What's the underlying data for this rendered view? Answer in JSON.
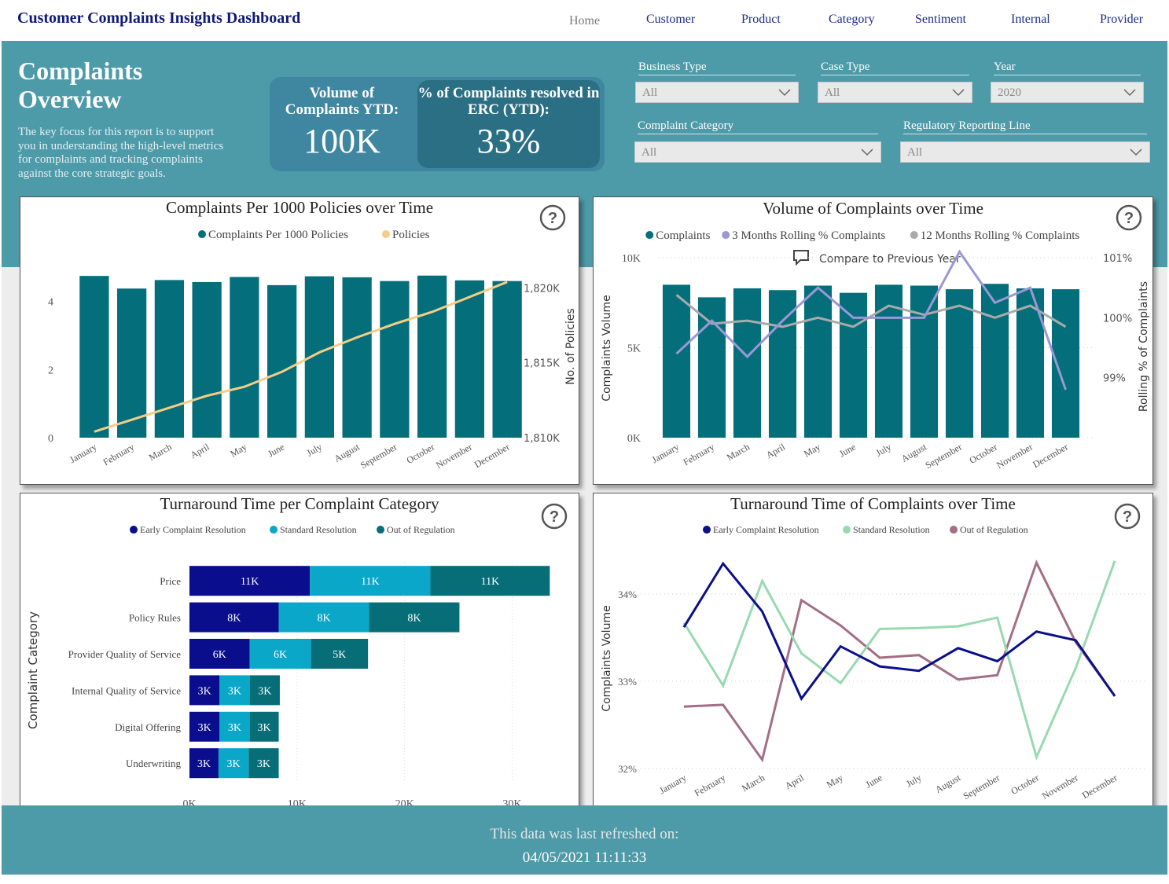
{
  "app": {
    "title": "Customer Complaints Insights Dashboard"
  },
  "nav": [
    "Home",
    "Customer",
    "Product",
    "Category",
    "Sentiment",
    "Internal",
    "Provider"
  ],
  "overview": {
    "title": "Complaints Overview",
    "description": "The key focus for this report is to support you in understanding the high-level metrics for complaints and tracking complaints against the core strategic goals."
  },
  "kpis": {
    "volume_label": "Volume of Complaints YTD:",
    "volume_value": "100K",
    "erc_label": "% of Complaints resolved in ERC (YTD):",
    "erc_value": "33%"
  },
  "filters": {
    "business_type": {
      "label": "Business Type",
      "value": "All"
    },
    "case_type": {
      "label": "Case Type",
      "value": "All"
    },
    "year": {
      "label": "Year",
      "value": "2020"
    },
    "complaint_category": {
      "label": "Complaint Category",
      "value": "All"
    },
    "regulatory_line": {
      "label": "Regulatory Reporting Line",
      "value": "All"
    }
  },
  "footer": {
    "refresh_label": "This data was last refreshed on:",
    "refresh_time": "04/05/2021 11:11:33"
  },
  "icons": {
    "help": "help-circle-icon",
    "compare": "comment-icon",
    "dropdown": "chevron-down-icon"
  },
  "colors": {
    "teal": "#046f7a",
    "policies": "#f6cd86",
    "rolling3": "#9a97d6",
    "rolling12": "#aaaaaa",
    "ecr": "#0a0e8c",
    "standard": "#0aa7c9",
    "oor": "#076e78",
    "ecr_line": "#0b0f8a",
    "standard_line": "#98d9b0",
    "oor_line": "#a26f85",
    "band": "#4d9aa8"
  },
  "chart_data": [
    {
      "type": "bar",
      "title": "Complaints Per 1000 Policies over Time",
      "legend": [
        "Complaints Per 1000 Policies",
        "Policies"
      ],
      "categories": [
        "January",
        "February",
        "March",
        "April",
        "May",
        "June",
        "July",
        "August",
        "September",
        "October",
        "November",
        "December"
      ],
      "series": [
        {
          "name": "Complaints Per 1000 Policies",
          "type": "bar",
          "axis": "left",
          "values": [
            4.75,
            4.38,
            4.63,
            4.57,
            4.72,
            4.48,
            4.74,
            4.71,
            4.6,
            4.76,
            4.62,
            4.6
          ]
        },
        {
          "name": "Policies",
          "type": "line",
          "axis": "right",
          "values": [
            1810.4,
            1811.2,
            1812.0,
            1812.8,
            1813.4,
            1814.4,
            1815.7,
            1816.7,
            1817.6,
            1818.4,
            1819.4,
            1820.4
          ]
        }
      ],
      "yticks": [
        "0",
        "2",
        "4"
      ],
      "y2ticks": [
        "1,810K",
        "1,815K",
        "1,820K"
      ],
      "ylim": [
        0,
        5.1
      ],
      "y2lim": [
        1810,
        1821.6
      ],
      "y2label": "No. of Policies"
    },
    {
      "type": "bar",
      "title": "Volume of Complaints over Time",
      "legend": [
        "Complaints",
        "3 Months Rolling % Complaints",
        "12 Months Rolling % Complaints"
      ],
      "compare_label": "Compare to Previous Year",
      "categories": [
        "January",
        "February",
        "March",
        "April",
        "May",
        "June",
        "July",
        "August",
        "September",
        "October",
        "November",
        "December"
      ],
      "series": [
        {
          "name": "Complaints",
          "type": "bar",
          "axis": "left",
          "values": [
            8.5,
            7.8,
            8.3,
            8.2,
            8.45,
            8.05,
            8.5,
            8.45,
            8.25,
            8.55,
            8.3,
            8.25
          ]
        },
        {
          "name": "3 Months Rolling % Complaints",
          "type": "line",
          "axis": "right",
          "values": [
            99.4,
            99.95,
            99.35,
            99.95,
            100.5,
            100.0,
            100.0,
            100.0,
            101.1,
            100.25,
            100.5,
            98.8
          ]
        },
        {
          "name": "12 Months Rolling % Complaints",
          "type": "line",
          "axis": "right",
          "values": [
            100.38,
            99.9,
            99.95,
            99.85,
            100.0,
            99.85,
            100.2,
            100.05,
            100.2,
            100.0,
            100.2,
            99.85
          ]
        }
      ],
      "yticks": [
        "0K",
        "5K",
        "10K"
      ],
      "y2ticks": [
        "99%",
        "100%",
        "101%"
      ],
      "ylim": [
        0,
        10
      ],
      "y2lim": [
        98.0,
        101.0
      ],
      "ylabel": "Complaints Volume",
      "y2label": "Rolling % of Complaints"
    },
    {
      "type": "bar",
      "orientation": "horizontal",
      "stacked": true,
      "title": "Turnaround Time per Complaint Category",
      "legend": [
        "Early Complaint Resolution",
        "Standard Resolution",
        "Out of Regulation"
      ],
      "categories": [
        "Price",
        "Policy Rules",
        "Provider Quality of Service",
        "Internal Quality of Service",
        "Digital Offering",
        "Underwriting"
      ],
      "series": [
        {
          "name": "Early Complaint Resolution",
          "values": [
            11.2,
            8.3,
            5.6,
            2.8,
            2.8,
            2.7
          ],
          "labels": [
            "11K",
            "8K",
            "6K",
            "3K",
            "3K",
            "3K"
          ]
        },
        {
          "name": "Standard Resolution",
          "values": [
            11.2,
            8.4,
            5.7,
            2.8,
            2.8,
            2.8
          ],
          "labels": [
            "11K",
            "8K",
            "6K",
            "3K",
            "3K",
            "3K"
          ]
        },
        {
          "name": "Out of Regulation",
          "values": [
            11.1,
            8.4,
            5.3,
            2.8,
            2.7,
            2.8
          ],
          "labels": [
            "11K",
            "8K",
            "5K",
            "3K",
            "3K",
            "3K"
          ]
        }
      ],
      "xticks": [
        "0K",
        "10K",
        "20K",
        "30K"
      ],
      "xlim": [
        0,
        33.4
      ],
      "ylabel": "Complaint Category"
    },
    {
      "type": "line",
      "title": "Turnaround Time of Complaints over Time",
      "legend": [
        "Early Complaint Resolution",
        "Standard Resolution",
        "Out of Regulation"
      ],
      "categories": [
        "January",
        "February",
        "March",
        "April",
        "May",
        "June",
        "July",
        "August",
        "September",
        "October",
        "November",
        "December"
      ],
      "series": [
        {
          "name": "Early Complaint Resolution",
          "values": [
            33.62,
            34.35,
            33.8,
            32.8,
            33.4,
            33.17,
            33.12,
            33.38,
            33.23,
            33.57,
            33.47,
            32.83
          ]
        },
        {
          "name": "Standard Resolution",
          "values": [
            33.67,
            32.95,
            34.15,
            33.32,
            32.98,
            33.6,
            33.61,
            33.63,
            33.73,
            32.13,
            33.15,
            34.38
          ]
        },
        {
          "name": "Out of Regulation",
          "values": [
            32.71,
            32.73,
            32.1,
            33.93,
            33.64,
            33.27,
            33.3,
            33.02,
            33.07,
            34.36,
            33.45,
            32.83
          ]
        }
      ],
      "yticks": [
        "32%",
        "33%",
        "34%"
      ],
      "ylim": [
        32.0,
        34.0
      ],
      "ylabel": "Complaints Volume"
    }
  ]
}
